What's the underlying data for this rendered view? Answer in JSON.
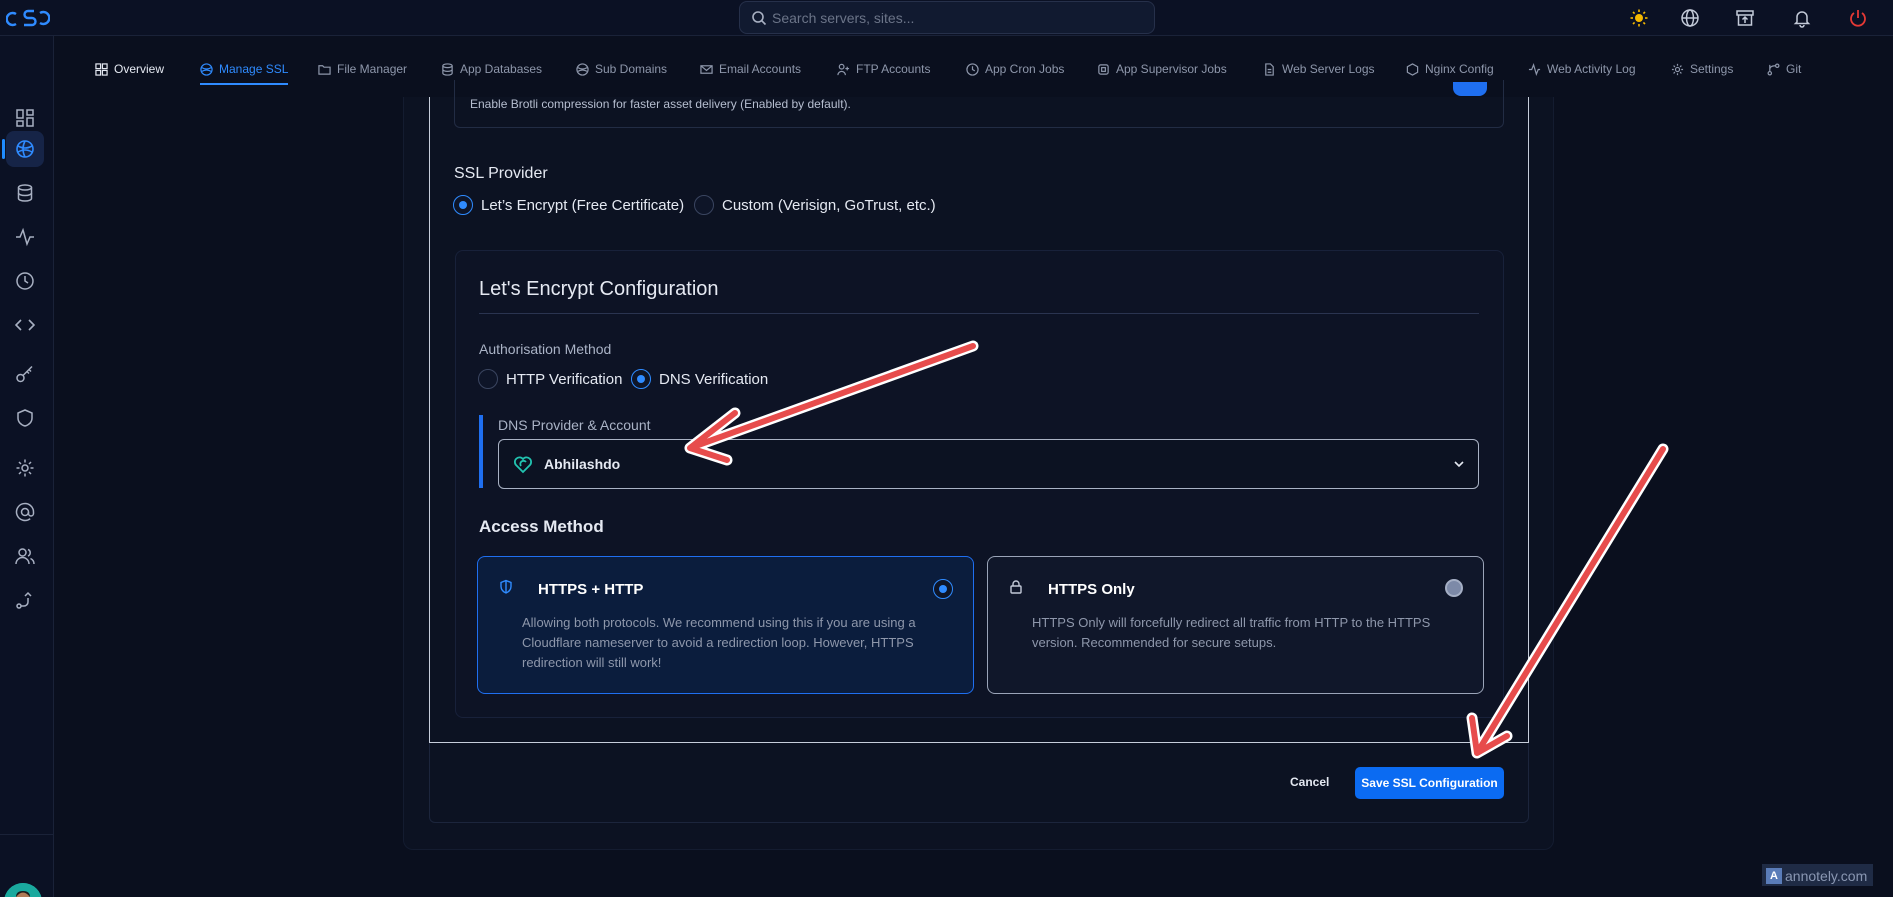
{
  "search": {
    "placeholder": "Search servers, sites..."
  },
  "nav": {
    "tabs": [
      {
        "label": "Overview"
      },
      {
        "label": "Manage SSL"
      },
      {
        "label": "File Manager"
      },
      {
        "label": "App Databases"
      },
      {
        "label": "Sub Domains"
      },
      {
        "label": "Email Accounts"
      },
      {
        "label": "FTP Accounts"
      },
      {
        "label": "App Cron Jobs"
      },
      {
        "label": "App Supervisor Jobs"
      },
      {
        "label": "Web Server Logs"
      },
      {
        "label": "Nginx Config"
      },
      {
        "label": "Web Activity Log"
      },
      {
        "label": "Settings"
      },
      {
        "label": "Git"
      }
    ],
    "active_tab": "Manage SSL"
  },
  "brotli": {
    "description": "Enable Brotli compression for faster asset delivery (Enabled by default).",
    "enabled": true
  },
  "ssl_provider": {
    "label": "SSL Provider",
    "options": [
      {
        "label": "Let’s Encrypt (Free Certificate)",
        "selected": true
      },
      {
        "label": "Custom (Verisign, GoTrust, etc.)",
        "selected": false
      }
    ]
  },
  "le_config": {
    "title": "Let's Encrypt Configuration",
    "auth_label": "Authorisation Method",
    "auth_options": [
      {
        "label": "HTTP Verification",
        "selected": false
      },
      {
        "label": "DNS Verification",
        "selected": true
      }
    ],
    "dns_label": "DNS Provider & Account",
    "dns_value": "Abhilashdo"
  },
  "access": {
    "title": "Access Method",
    "options": [
      {
        "title": "HTTPS + HTTP",
        "description": "Allowing both protocols. We recommend using this if you are using a Cloudflare nameserver to avoid a redirection loop. However, HTTPS redirection will still work!",
        "selected": true
      },
      {
        "title": "HTTPS Only",
        "description": "HTTPS Only will forcefully redirect all traffic from HTTP to the HTTPS version. Recommended for secure setups.",
        "selected": false
      }
    ]
  },
  "footer": {
    "cancel_label": "Cancel",
    "save_label": "Save SSL Configuration"
  },
  "watermark": {
    "text": "annotely.com",
    "badge": "A"
  },
  "colors": {
    "accent": "#1f6ff0",
    "annotation_arrow": "#e74c4c",
    "background": "#0a0f1e"
  }
}
